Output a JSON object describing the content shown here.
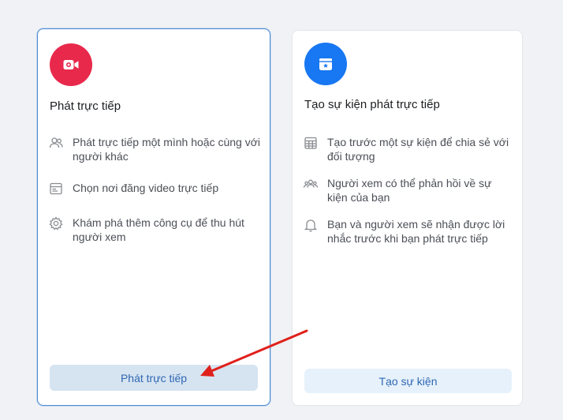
{
  "live_card": {
    "title": "Phát trực tiếp",
    "features": [
      {
        "icon": "people-icon",
        "text": "Phát trực tiếp một mình hoặc cùng với người khác"
      },
      {
        "icon": "browser-window-icon",
        "text": "Chọn nơi đăng video trực tiếp"
      },
      {
        "icon": "gear-icon",
        "text": "Khám phá thêm công cụ để thu hút người xem"
      }
    ],
    "button_label": "Phát trực tiếp",
    "badge_icon": "video-camera-icon",
    "badge_color": "#e8294c"
  },
  "event_card": {
    "title": "Tạo sự kiện phát trực tiếp",
    "features": [
      {
        "icon": "calendar-grid-icon",
        "text": "Tạo trước một sự kiện để chia sẻ với đối tượng"
      },
      {
        "icon": "audience-icon",
        "text": "Người xem có thể phản hồi về sự kiện của bạn"
      },
      {
        "icon": "bell-icon",
        "text": "Bạn và người xem sẽ nhận được lời nhắc trước khi bạn phát trực tiếp"
      }
    ],
    "button_label": "Tạo sự kiện",
    "badge_icon": "calendar-star-icon",
    "badge_color": "#1877f2"
  },
  "annotation": {
    "arrow_color": "#e0201b"
  }
}
